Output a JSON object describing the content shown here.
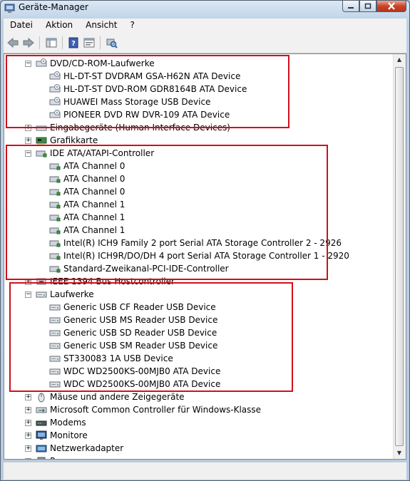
{
  "window": {
    "title": "Geräte-Manager"
  },
  "menubar": {
    "items": [
      "Datei",
      "Aktion",
      "Ansicht",
      "?"
    ]
  },
  "tree": {
    "rows": [
      {
        "label": "DVD/CD-ROM-Laufwerke",
        "level": 0,
        "expander": "minus",
        "icon": "dvd-drive-icon"
      },
      {
        "label": "HL-DT-ST DVDRAM GSA-H62N ATA Device",
        "level": 1,
        "icon": "dvd-drive-icon"
      },
      {
        "label": "HL-DT-ST DVD-ROM GDR8164B ATA Device",
        "level": 1,
        "icon": "dvd-drive-icon"
      },
      {
        "label": "HUAWEI Mass Storage USB Device",
        "level": 1,
        "icon": "dvd-drive-icon"
      },
      {
        "label": "PIONEER DVD RW  DVR-109 ATA Device",
        "level": 1,
        "icon": "dvd-drive-icon"
      },
      {
        "label": "Eingabegeräte (Human Interface Devices)",
        "level": 0,
        "expander": "plus",
        "icon": "hid-icon"
      },
      {
        "label": "Grafikkarte",
        "level": 0,
        "expander": "plus",
        "icon": "display-adapter-icon"
      },
      {
        "label": "IDE ATA/ATAPI-Controller",
        "level": 0,
        "expander": "minus",
        "icon": "controller-icon"
      },
      {
        "label": "ATA Channel 0",
        "level": 1,
        "icon": "controller-icon"
      },
      {
        "label": "ATA Channel 0",
        "level": 1,
        "icon": "controller-icon"
      },
      {
        "label": "ATA Channel 0",
        "level": 1,
        "icon": "controller-icon"
      },
      {
        "label": "ATA Channel 1",
        "level": 1,
        "icon": "controller-icon"
      },
      {
        "label": "ATA Channel 1",
        "level": 1,
        "icon": "controller-icon"
      },
      {
        "label": "ATA Channel 1",
        "level": 1,
        "icon": "controller-icon"
      },
      {
        "label": "Intel(R) ICH9 Family 2 port Serial ATA Storage Controller 2 - 2926",
        "level": 1,
        "icon": "controller-icon"
      },
      {
        "label": "Intel(R) ICH9R/DO/DH 4 port Serial ATA Storage Controller 1 - 2920",
        "level": 1,
        "icon": "controller-icon"
      },
      {
        "label": "Standard-Zweikanal-PCI-IDE-Controller",
        "level": 1,
        "icon": "controller-icon"
      },
      {
        "label": "IEEE 1394 Bus Hostcontroller",
        "level": 0,
        "expander": "plus",
        "icon": "firewire-icon"
      },
      {
        "label": "Laufwerke",
        "level": 0,
        "expander": "minus",
        "icon": "hard-disk-icon"
      },
      {
        "label": "Generic USB CF Reader USB Device",
        "level": 1,
        "icon": "hard-disk-icon"
      },
      {
        "label": "Generic USB MS Reader USB Device",
        "level": 1,
        "icon": "hard-disk-icon"
      },
      {
        "label": "Generic USB SD Reader USB Device",
        "level": 1,
        "icon": "hard-disk-icon"
      },
      {
        "label": "Generic USB SM Reader USB Device",
        "level": 1,
        "icon": "hard-disk-icon"
      },
      {
        "label": "ST330083 1A USB Device",
        "level": 1,
        "icon": "hard-disk-icon"
      },
      {
        "label": "WDC WD2500KS-00MJB0 ATA Device",
        "level": 1,
        "icon": "hard-disk-icon"
      },
      {
        "label": "WDC WD2500KS-00MJB0 ATA Device",
        "level": 1,
        "icon": "hard-disk-icon"
      },
      {
        "label": "Mäuse und andere Zeigegeräte",
        "level": 0,
        "expander": "plus",
        "icon": "mouse-icon"
      },
      {
        "label": "Microsoft Common Controller für Windows-Klasse",
        "level": 0,
        "expander": "plus",
        "icon": "usb-controller-icon"
      },
      {
        "label": "Modems",
        "level": 0,
        "expander": "plus",
        "icon": "modem-icon"
      },
      {
        "label": "Monitore",
        "level": 0,
        "expander": "plus",
        "icon": "monitor-icon"
      },
      {
        "label": "Netzwerkadapter",
        "level": 0,
        "expander": "plus",
        "icon": "network-adapter-icon"
      },
      {
        "label": "Prozessoren",
        "level": 0,
        "expander": "plus",
        "icon": "processor-icon"
      }
    ]
  },
  "colors": {
    "highlight_box": "#d0101c"
  }
}
